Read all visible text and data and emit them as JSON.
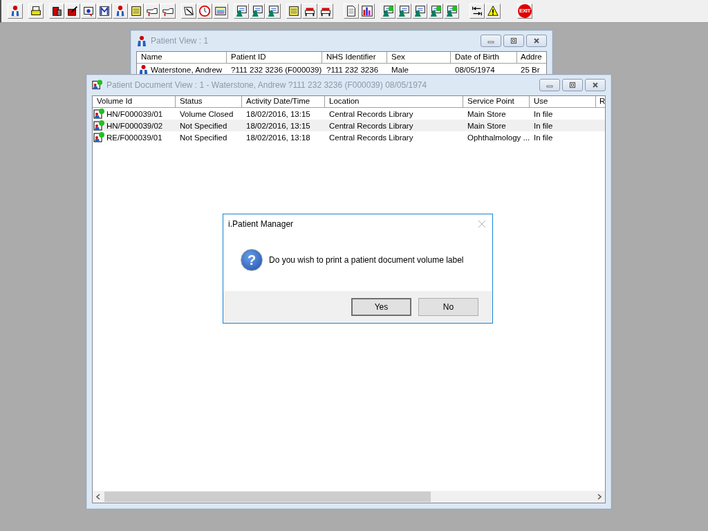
{
  "toolbar": {
    "exit_label": "EXIT"
  },
  "patient_view": {
    "title": "Patient View : 1",
    "columns": [
      "Name",
      "Patient ID",
      "NHS Identifier",
      "Sex",
      "Date of Birth",
      "Addre"
    ],
    "rows": [
      {
        "cells": [
          "Waterstone, Andrew",
          "?111 232 3236 (F000039)",
          "?111 232 3236",
          "Male",
          "08/05/1974",
          "25 Br"
        ]
      }
    ]
  },
  "document_view": {
    "title": "Patient Document View : 1 - Waterstone, Andrew ?111 232 3236 (F000039) 08/05/1974",
    "columns": [
      "Volume Id",
      "Status",
      "Activity Date/Time",
      "Location",
      "Service Point",
      "Use",
      "R"
    ],
    "rows": [
      {
        "cells": [
          "HN/F000039/01",
          "Volume Closed",
          "18/02/2016, 13:15",
          "Central Records Library",
          "Main Store",
          "In file",
          ""
        ]
      },
      {
        "cells": [
          "HN/F000039/02",
          "Not Specified",
          "18/02/2016, 13:15",
          "Central Records Library",
          "Main Store",
          "In file",
          ""
        ]
      },
      {
        "cells": [
          "RE/F000039/01",
          "Not Specified",
          "18/02/2016, 13:18",
          "Central Records Library",
          "Ophthalmology ...",
          "In file",
          ""
        ]
      }
    ]
  },
  "dialog": {
    "title": "i.Patient Manager",
    "icon_glyph": "?",
    "message": "Do you wish to print a patient document volume label",
    "buttons": [
      "Yes",
      "No"
    ]
  }
}
